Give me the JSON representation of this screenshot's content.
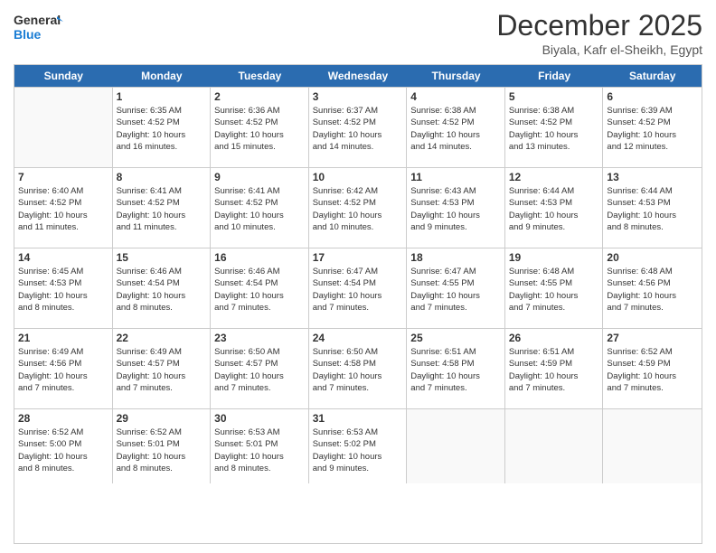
{
  "header": {
    "logo_general": "General",
    "logo_blue": "Blue",
    "title": "December 2025",
    "location": "Biyala, Kafr el-Sheikh, Egypt"
  },
  "days_of_week": [
    "Sunday",
    "Monday",
    "Tuesday",
    "Wednesday",
    "Thursday",
    "Friday",
    "Saturday"
  ],
  "weeks": [
    [
      {
        "day": "",
        "info": ""
      },
      {
        "day": "1",
        "info": "Sunrise: 6:35 AM\nSunset: 4:52 PM\nDaylight: 10 hours\nand 16 minutes."
      },
      {
        "day": "2",
        "info": "Sunrise: 6:36 AM\nSunset: 4:52 PM\nDaylight: 10 hours\nand 15 minutes."
      },
      {
        "day": "3",
        "info": "Sunrise: 6:37 AM\nSunset: 4:52 PM\nDaylight: 10 hours\nand 14 minutes."
      },
      {
        "day": "4",
        "info": "Sunrise: 6:38 AM\nSunset: 4:52 PM\nDaylight: 10 hours\nand 14 minutes."
      },
      {
        "day": "5",
        "info": "Sunrise: 6:38 AM\nSunset: 4:52 PM\nDaylight: 10 hours\nand 13 minutes."
      },
      {
        "day": "6",
        "info": "Sunrise: 6:39 AM\nSunset: 4:52 PM\nDaylight: 10 hours\nand 12 minutes."
      }
    ],
    [
      {
        "day": "7",
        "info": "Sunrise: 6:40 AM\nSunset: 4:52 PM\nDaylight: 10 hours\nand 11 minutes."
      },
      {
        "day": "8",
        "info": "Sunrise: 6:41 AM\nSunset: 4:52 PM\nDaylight: 10 hours\nand 11 minutes."
      },
      {
        "day": "9",
        "info": "Sunrise: 6:41 AM\nSunset: 4:52 PM\nDaylight: 10 hours\nand 10 minutes."
      },
      {
        "day": "10",
        "info": "Sunrise: 6:42 AM\nSunset: 4:52 PM\nDaylight: 10 hours\nand 10 minutes."
      },
      {
        "day": "11",
        "info": "Sunrise: 6:43 AM\nSunset: 4:53 PM\nDaylight: 10 hours\nand 9 minutes."
      },
      {
        "day": "12",
        "info": "Sunrise: 6:44 AM\nSunset: 4:53 PM\nDaylight: 10 hours\nand 9 minutes."
      },
      {
        "day": "13",
        "info": "Sunrise: 6:44 AM\nSunset: 4:53 PM\nDaylight: 10 hours\nand 8 minutes."
      }
    ],
    [
      {
        "day": "14",
        "info": "Sunrise: 6:45 AM\nSunset: 4:53 PM\nDaylight: 10 hours\nand 8 minutes."
      },
      {
        "day": "15",
        "info": "Sunrise: 6:46 AM\nSunset: 4:54 PM\nDaylight: 10 hours\nand 8 minutes."
      },
      {
        "day": "16",
        "info": "Sunrise: 6:46 AM\nSunset: 4:54 PM\nDaylight: 10 hours\nand 7 minutes."
      },
      {
        "day": "17",
        "info": "Sunrise: 6:47 AM\nSunset: 4:54 PM\nDaylight: 10 hours\nand 7 minutes."
      },
      {
        "day": "18",
        "info": "Sunrise: 6:47 AM\nSunset: 4:55 PM\nDaylight: 10 hours\nand 7 minutes."
      },
      {
        "day": "19",
        "info": "Sunrise: 6:48 AM\nSunset: 4:55 PM\nDaylight: 10 hours\nand 7 minutes."
      },
      {
        "day": "20",
        "info": "Sunrise: 6:48 AM\nSunset: 4:56 PM\nDaylight: 10 hours\nand 7 minutes."
      }
    ],
    [
      {
        "day": "21",
        "info": "Sunrise: 6:49 AM\nSunset: 4:56 PM\nDaylight: 10 hours\nand 7 minutes."
      },
      {
        "day": "22",
        "info": "Sunrise: 6:49 AM\nSunset: 4:57 PM\nDaylight: 10 hours\nand 7 minutes."
      },
      {
        "day": "23",
        "info": "Sunrise: 6:50 AM\nSunset: 4:57 PM\nDaylight: 10 hours\nand 7 minutes."
      },
      {
        "day": "24",
        "info": "Sunrise: 6:50 AM\nSunset: 4:58 PM\nDaylight: 10 hours\nand 7 minutes."
      },
      {
        "day": "25",
        "info": "Sunrise: 6:51 AM\nSunset: 4:58 PM\nDaylight: 10 hours\nand 7 minutes."
      },
      {
        "day": "26",
        "info": "Sunrise: 6:51 AM\nSunset: 4:59 PM\nDaylight: 10 hours\nand 7 minutes."
      },
      {
        "day": "27",
        "info": "Sunrise: 6:52 AM\nSunset: 4:59 PM\nDaylight: 10 hours\nand 7 minutes."
      }
    ],
    [
      {
        "day": "28",
        "info": "Sunrise: 6:52 AM\nSunset: 5:00 PM\nDaylight: 10 hours\nand 8 minutes."
      },
      {
        "day": "29",
        "info": "Sunrise: 6:52 AM\nSunset: 5:01 PM\nDaylight: 10 hours\nand 8 minutes."
      },
      {
        "day": "30",
        "info": "Sunrise: 6:53 AM\nSunset: 5:01 PM\nDaylight: 10 hours\nand 8 minutes."
      },
      {
        "day": "31",
        "info": "Sunrise: 6:53 AM\nSunset: 5:02 PM\nDaylight: 10 hours\nand 9 minutes."
      },
      {
        "day": "",
        "info": ""
      },
      {
        "day": "",
        "info": ""
      },
      {
        "day": "",
        "info": ""
      }
    ]
  ]
}
